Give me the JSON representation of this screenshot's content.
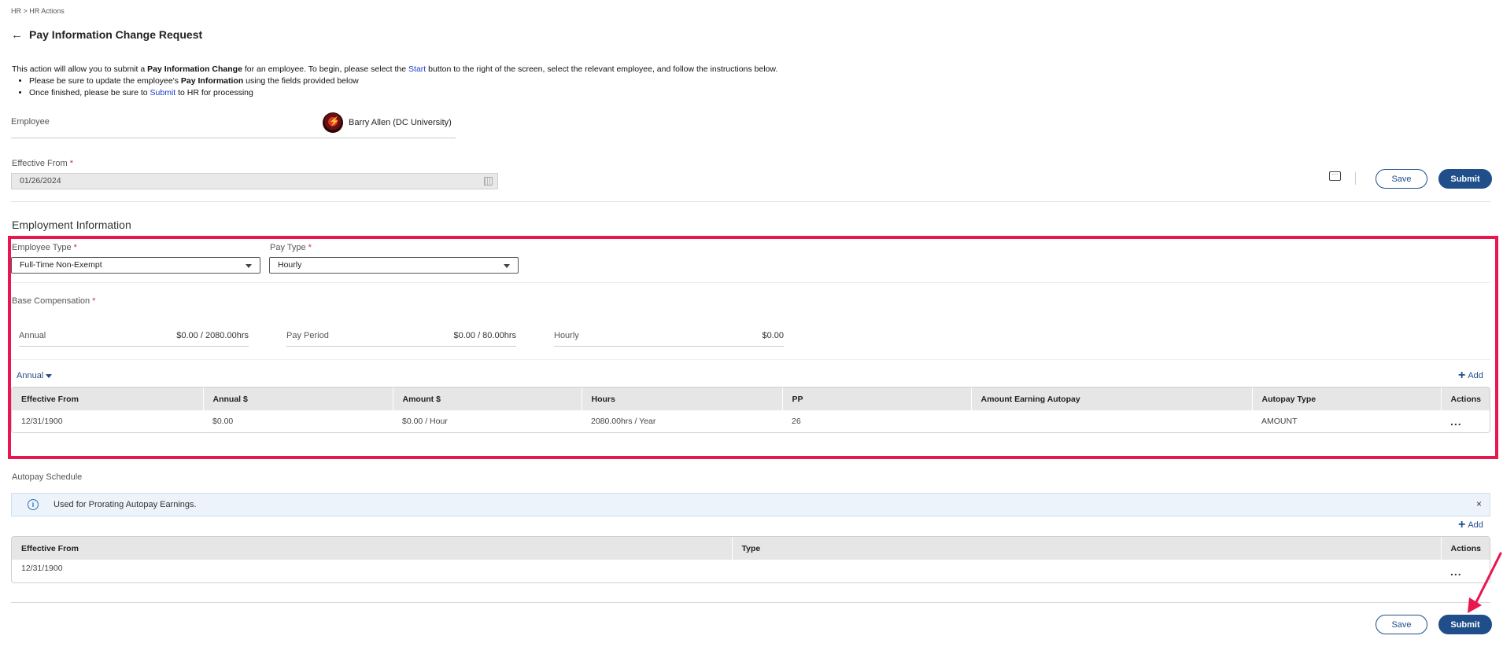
{
  "breadcrumb": "HR > HR Actions",
  "page_title": "Pay Information Change Request",
  "intro": {
    "p1_a": "This action will allow you to submit a ",
    "p1_b": "Pay Information Change",
    "p1_c": " for an employee. To begin, please select the ",
    "p1_link": "Start",
    "p1_d": " button to the right of the screen, select the relevant employee, and follow the instructions below.",
    "b1_a": "Please be sure to update the employee's ",
    "b1_b": "Pay Information",
    "b1_c": " using the fields provided below",
    "b2_a": "Once finished, please be sure to ",
    "b2_link": "Submit",
    "b2_c": " to HR for processing"
  },
  "employee": {
    "label": "Employee",
    "name": "Barry Allen (DC University)"
  },
  "effective_from": {
    "label": "Effective From",
    "required": "*",
    "value": "01/26/2024"
  },
  "actions": {
    "save": "Save",
    "submit": "Submit"
  },
  "employment": {
    "title": "Employment Information",
    "employee_type": {
      "label": "Employee Type",
      "value": "Full-Time Non-Exempt"
    },
    "pay_type": {
      "label": "Pay Type",
      "value": "Hourly"
    },
    "base_comp_label": "Base Compensation",
    "comp": [
      {
        "label": "Annual",
        "value": "$0.00 / 2080.00hrs"
      },
      {
        "label": "Pay Period",
        "value": "$0.00 / 80.00hrs"
      },
      {
        "label": "Hourly",
        "value": "$0.00"
      }
    ],
    "view_select": "Annual",
    "add": "Add",
    "table": {
      "headers": [
        "Effective From",
        "Annual $",
        "Amount $",
        "Hours",
        "PP",
        "Amount Earning Autopay",
        "Autopay Type",
        "Actions"
      ],
      "rows": [
        [
          "12/31/1900",
          "$0.00",
          "$0.00 / Hour",
          "2080.00hrs / Year",
          "26",
          "",
          "AMOUNT",
          "..."
        ]
      ]
    }
  },
  "autopay": {
    "title": "Autopay Schedule",
    "info": "Used for Prorating Autopay Earnings.",
    "close": "×",
    "add": "Add",
    "table": {
      "headers": [
        "Effective From",
        "Type",
        "Actions"
      ],
      "rows": [
        [
          "12/31/1900",
          "",
          "..."
        ]
      ]
    }
  },
  "colors": {
    "primary": "#1f4e8a",
    "highlight": "#e8174f",
    "link": "#1a3fcc"
  }
}
